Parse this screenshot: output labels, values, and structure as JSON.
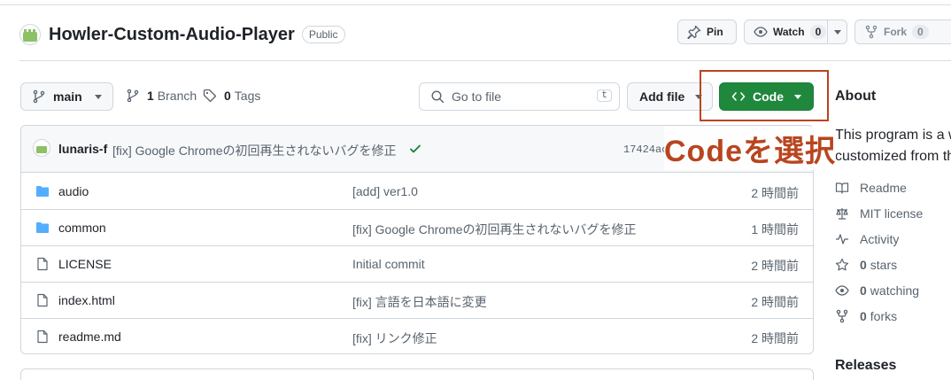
{
  "repo": {
    "name": "Howler-Custom-Audio-Player",
    "visibility": "Public"
  },
  "header_actions": {
    "pin": "Pin",
    "watch": "Watch",
    "watch_count": "0",
    "fork": "Fork",
    "fork_count": "0"
  },
  "toolbar": {
    "branch": "main",
    "branch_count": "1",
    "branch_suffix": "Branch",
    "tag_count": "0",
    "tag_suffix": "Tags",
    "search_placeholder": "Go to file",
    "search_shortcut": "t",
    "add_file": "Add file",
    "code": "Code"
  },
  "annotation": {
    "callout": "Codeを選択",
    "color": "#b8451e"
  },
  "latest_commit": {
    "user": "lunaris-f",
    "message": "[fix] Google Chromeの初回再生されないバグを修正",
    "hash": "17424ac",
    "status": "success"
  },
  "files": [
    {
      "type": "folder",
      "name": "audio",
      "message": "[add] ver1.0",
      "time": "2 時間前"
    },
    {
      "type": "folder",
      "name": "common",
      "message": "[fix] Google Chromeの初回再生されないバグを修正",
      "time": "1 時間前"
    },
    {
      "type": "file",
      "name": "LICENSE",
      "message": "Initial commit",
      "time": "2 時間前"
    },
    {
      "type": "file",
      "name": "index.html",
      "message": "[fix] 言語を日本語に変更",
      "time": "2 時間前"
    },
    {
      "type": "file",
      "name": "readme.md",
      "message": "[fix] リンク修正",
      "time": "2 時間前"
    }
  ],
  "about": {
    "title": "About",
    "desc_line1": "This program is a w",
    "desc_line2": "customized from th",
    "readme": "Readme",
    "license": "MIT license",
    "activity": "Activity",
    "stars_count": "0",
    "stars_label": "stars",
    "watching_count": "0",
    "watching_label": "watching",
    "forks_count": "0",
    "forks_label": "forks",
    "releases": "Releases"
  },
  "colors": {
    "code_button": "#1f883d",
    "folder_icon": "#54aeff",
    "highlight": "#b8451e"
  }
}
